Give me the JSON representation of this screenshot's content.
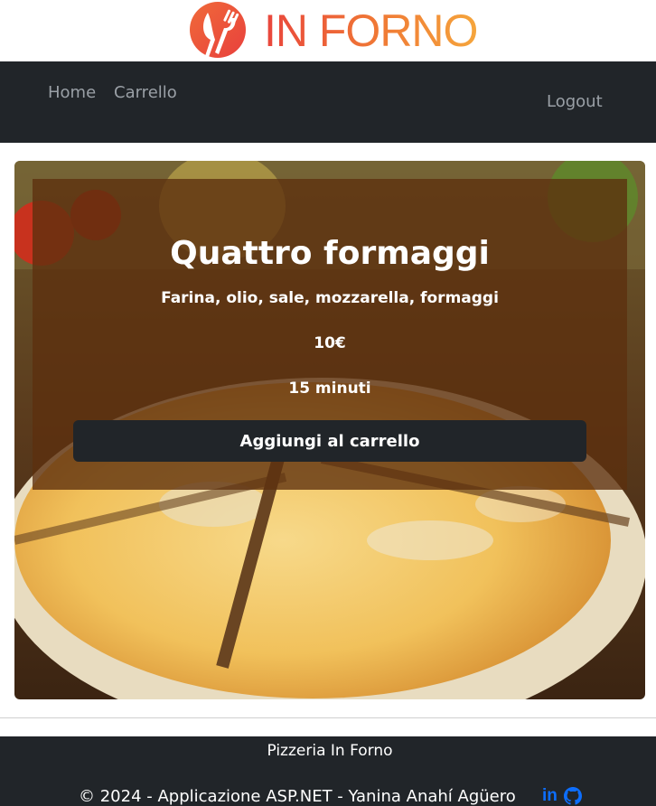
{
  "brand": {
    "name": "IN FORNO"
  },
  "nav": {
    "home": "Home",
    "cart": "Carrello",
    "logout": "Logout"
  },
  "product": {
    "name": "Quattro formaggi",
    "ingredients": "Farina, olio, sale, mozzarella, formaggi",
    "price": "10€",
    "time": "15 minuti",
    "add_button": "Aggiungi al carrello"
  },
  "footer": {
    "name": "Pizzeria In Forno",
    "copyright": "© 2024 - Applicazione ASP.NET - Yanina Anahí Agüero",
    "linkedin_text": "in",
    "social_icons": [
      "linkedin-icon",
      "github-icon"
    ]
  },
  "colors": {
    "brand_gradient_start": "#e9463c",
    "brand_gradient_end": "#f5a53c",
    "navbar_bg": "#212529",
    "overlay_bg": "#5c300e",
    "link_blue": "#0d6efd"
  }
}
